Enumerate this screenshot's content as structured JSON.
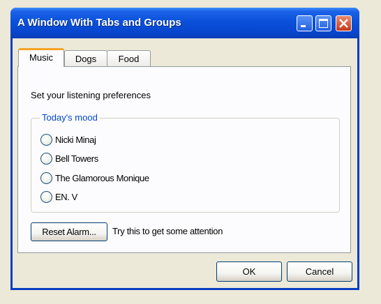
{
  "window": {
    "title": "A Window With Tabs and Groups",
    "controls": {
      "minimize": "minimize-icon",
      "maximize": "maximize-icon",
      "close": "close-icon"
    }
  },
  "tabs": [
    {
      "label": "Music",
      "selected": true
    },
    {
      "label": "Dogs",
      "selected": false
    },
    {
      "label": "Food",
      "selected": false
    }
  ],
  "music_panel": {
    "prompt": "Set your listening preferences",
    "group_title": "Today's mood",
    "options": [
      {
        "label": "Nicki Minaj",
        "checked": false
      },
      {
        "label": "Bell Towers",
        "checked": false
      },
      {
        "label": "The Glamorous Monique",
        "checked": false
      },
      {
        "label": "EN. V",
        "checked": false
      }
    ],
    "reset_button": "Reset Alarm...",
    "reset_hint": "Try this to get some attention"
  },
  "dialog_buttons": {
    "ok": "OK",
    "cancel": "Cancel"
  },
  "colors": {
    "titlebar": "#0A51DA",
    "active_tab_accent": "#F5A323",
    "group_title": "#0046D5",
    "background": "#ECE9D8"
  }
}
